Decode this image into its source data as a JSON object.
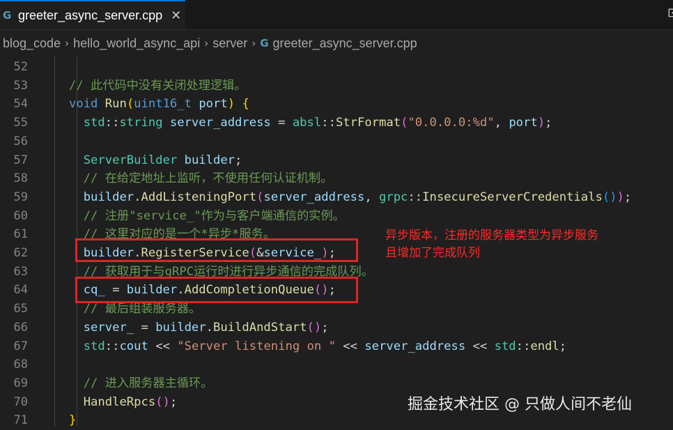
{
  "tab": {
    "icon": "cpp-file-icon",
    "title": "greeter_async_server.cpp",
    "close": "✕"
  },
  "breadcrumb": {
    "items": [
      "blog_code",
      "hello_world_async_api",
      "server",
      "greeter_async_server.cpp"
    ]
  },
  "lines": [
    {
      "n": "52",
      "tokens": []
    },
    {
      "n": "53",
      "tokens": [
        [
          "c",
          "// 此代码中没有关闭处理逻辑。"
        ]
      ]
    },
    {
      "n": "54",
      "tokens": [
        [
          "k",
          "void"
        ],
        [
          "p",
          " "
        ],
        [
          "f",
          "Run"
        ],
        [
          "by",
          "("
        ],
        [
          "k",
          "uint16_t"
        ],
        [
          "p",
          " "
        ],
        [
          "v",
          "port"
        ],
        [
          "by",
          ")"
        ],
        [
          "p",
          " "
        ],
        [
          "by",
          "{"
        ]
      ]
    },
    {
      "n": "55",
      "tokens": [
        [
          "p",
          "  "
        ],
        [
          "t",
          "std"
        ],
        [
          "p",
          "::"
        ],
        [
          "t",
          "string"
        ],
        [
          "p",
          " "
        ],
        [
          "v",
          "server_address"
        ],
        [
          "p",
          " = "
        ],
        [
          "t",
          "absl"
        ],
        [
          "p",
          "::"
        ],
        [
          "f",
          "StrFormat"
        ],
        [
          "bp",
          "("
        ],
        [
          "s",
          "\"0.0.0.0:%d\""
        ],
        [
          "p",
          ", "
        ],
        [
          "v",
          "port"
        ],
        [
          "bp",
          ")"
        ],
        [
          "p",
          ";"
        ]
      ]
    },
    {
      "n": "56",
      "tokens": []
    },
    {
      "n": "57",
      "tokens": [
        [
          "p",
          "  "
        ],
        [
          "t",
          "ServerBuilder"
        ],
        [
          "p",
          " "
        ],
        [
          "v",
          "builder"
        ],
        [
          "p",
          ";"
        ]
      ]
    },
    {
      "n": "58",
      "tokens": [
        [
          "p",
          "  "
        ],
        [
          "c",
          "// 在给定地址上监听，不使用任何认证机制。"
        ]
      ]
    },
    {
      "n": "59",
      "tokens": [
        [
          "p",
          "  "
        ],
        [
          "v",
          "builder"
        ],
        [
          "p",
          "."
        ],
        [
          "f",
          "AddListeningPort"
        ],
        [
          "bp",
          "("
        ],
        [
          "v",
          "server_address"
        ],
        [
          "p",
          ", "
        ],
        [
          "t",
          "grpc"
        ],
        [
          "p",
          "::"
        ],
        [
          "f",
          "InsecureServerCredentials"
        ],
        [
          "bb",
          "()"
        ],
        [
          "bp",
          ")"
        ],
        [
          "p",
          ";"
        ]
      ]
    },
    {
      "n": "60",
      "tokens": [
        [
          "p",
          "  "
        ],
        [
          "c",
          "// 注册\"service_\"作为与客户端通信的实例。"
        ]
      ]
    },
    {
      "n": "61",
      "tokens": [
        [
          "p",
          "  "
        ],
        [
          "c",
          "// 这里对应的是一个*异步*服务。"
        ]
      ]
    },
    {
      "n": "62",
      "tokens": [
        [
          "p",
          "  "
        ],
        [
          "v",
          "builder"
        ],
        [
          "p",
          "."
        ],
        [
          "f",
          "RegisterService"
        ],
        [
          "bp",
          "("
        ],
        [
          "p",
          "&"
        ],
        [
          "v",
          "service_"
        ],
        [
          "bp",
          ")"
        ],
        [
          "p",
          ";"
        ]
      ]
    },
    {
      "n": "63",
      "tokens": [
        [
          "p",
          "  "
        ],
        [
          "c",
          "// 获取用于与gRPC运行时进行异步通信的完成队列。"
        ]
      ]
    },
    {
      "n": "64",
      "tokens": [
        [
          "p",
          "  "
        ],
        [
          "v",
          "cq_"
        ],
        [
          "p",
          " = "
        ],
        [
          "v",
          "builder"
        ],
        [
          "p",
          "."
        ],
        [
          "f",
          "AddCompletionQueue"
        ],
        [
          "bp",
          "()"
        ],
        [
          "p",
          ";"
        ]
      ]
    },
    {
      "n": "65",
      "tokens": [
        [
          "p",
          "  "
        ],
        [
          "c",
          "// 最后组装服务器。"
        ]
      ]
    },
    {
      "n": "66",
      "tokens": [
        [
          "p",
          "  "
        ],
        [
          "v",
          "server_"
        ],
        [
          "p",
          " = "
        ],
        [
          "v",
          "builder"
        ],
        [
          "p",
          "."
        ],
        [
          "f",
          "BuildAndStart"
        ],
        [
          "bp",
          "()"
        ],
        [
          "p",
          ";"
        ]
      ]
    },
    {
      "n": "67",
      "tokens": [
        [
          "p",
          "  "
        ],
        [
          "t",
          "std"
        ],
        [
          "p",
          "::"
        ],
        [
          "v",
          "cout"
        ],
        [
          "p",
          " << "
        ],
        [
          "s",
          "\"Server listening on \""
        ],
        [
          "p",
          " << "
        ],
        [
          "v",
          "server_address"
        ],
        [
          "p",
          " << "
        ],
        [
          "t",
          "std"
        ],
        [
          "p",
          "::"
        ],
        [
          "f",
          "endl"
        ],
        [
          "p",
          ";"
        ]
      ]
    },
    {
      "n": "68",
      "tokens": []
    },
    {
      "n": "69",
      "tokens": [
        [
          "p",
          "  "
        ],
        [
          "c",
          "// 进入服务器主循环。"
        ]
      ]
    },
    {
      "n": "70",
      "tokens": [
        [
          "p",
          "  "
        ],
        [
          "f",
          "HandleRpcs"
        ],
        [
          "bp",
          "()"
        ],
        [
          "p",
          ";"
        ]
      ]
    },
    {
      "n": "71",
      "tokens": [
        [
          "by",
          "}"
        ]
      ]
    }
  ],
  "annotation": {
    "line1": "异步版本，注册的服务器类型为异步服务",
    "line2": "且增加了完成队列"
  },
  "watermark": "掘金技术社区 @ 只做人间不老仙",
  "colors": {
    "highlight_box": "#e02424",
    "annotation_text": "#ff2a2a",
    "tab_accent": "#0078d4"
  }
}
